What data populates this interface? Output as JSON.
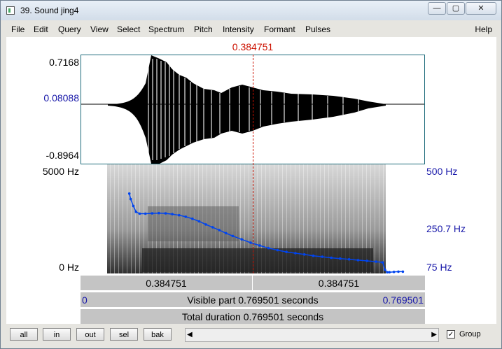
{
  "window": {
    "title": "39. Sound jing4",
    "buttons": {
      "minimize": "—",
      "restore": "▢",
      "close": "✕"
    }
  },
  "menu": {
    "items": [
      "File",
      "Edit",
      "Query",
      "View",
      "Select",
      "Spectrum",
      "Pitch",
      "Intensity",
      "Formant",
      "Pulses"
    ],
    "help": "Help"
  },
  "cursor": {
    "time_label": "0.384751"
  },
  "waveform": {
    "ymax": "0.7168",
    "yvalue": "0.08088",
    "ymin": "-0.8964"
  },
  "spectrogram": {
    "freq_max": "5000 Hz",
    "freq_min": "0 Hz"
  },
  "pitch": {
    "max": "500 Hz",
    "mid": "250.7 Hz",
    "min": "75 Hz"
  },
  "chart_data": {
    "type": "line",
    "title": "",
    "xlabel": "",
    "ylabel": "",
    "x_unit": "seconds",
    "y_unit": "Hz",
    "x": [
      0.109,
      0.112,
      0.118,
      0.124,
      0.132,
      0.145,
      0.16,
      0.175,
      0.19,
      0.205,
      0.22,
      0.235,
      0.25,
      0.265,
      0.28,
      0.295,
      0.31,
      0.325,
      0.34,
      0.36,
      0.38,
      0.4,
      0.42,
      0.44,
      0.46,
      0.48,
      0.5,
      0.52,
      0.54,
      0.56,
      0.58,
      0.6,
      0.62,
      0.64,
      0.66,
      0.675,
      0.68,
      0.685,
      0.69,
      0.7,
      0.71,
      0.72
    ],
    "y": [
      386,
      365,
      338,
      315,
      308,
      308,
      309,
      310,
      309,
      306,
      302,
      296,
      288,
      278,
      266,
      255,
      244,
      232,
      221,
      208,
      195,
      184,
      174,
      166,
      159,
      154,
      149,
      144,
      140,
      136,
      133,
      130,
      127,
      124,
      121,
      118,
      90,
      80,
      80,
      81,
      82,
      82
    ],
    "ylim": [
      75,
      500
    ],
    "xlim": [
      0,
      0.769501
    ]
  },
  "selection": {
    "left_label": "0.384751",
    "right_label": "0.384751"
  },
  "visible": {
    "start": "0",
    "text": "Visible part 0.769501 seconds",
    "end": "0.769501"
  },
  "total": {
    "text": "Total duration 0.769501 seconds"
  },
  "toolbar": {
    "all": "all",
    "in": "in",
    "out": "out",
    "sel": "sel",
    "bak": "bak",
    "group_label": "Group",
    "group_checked": "✓",
    "scroll_left": "◀",
    "scroll_right": "▶"
  },
  "colors": {
    "cursor": "#cc1100",
    "pitch": "#0044ee",
    "axis_blue": "#1a1aaa",
    "wave_border": "#1d6b7a"
  }
}
